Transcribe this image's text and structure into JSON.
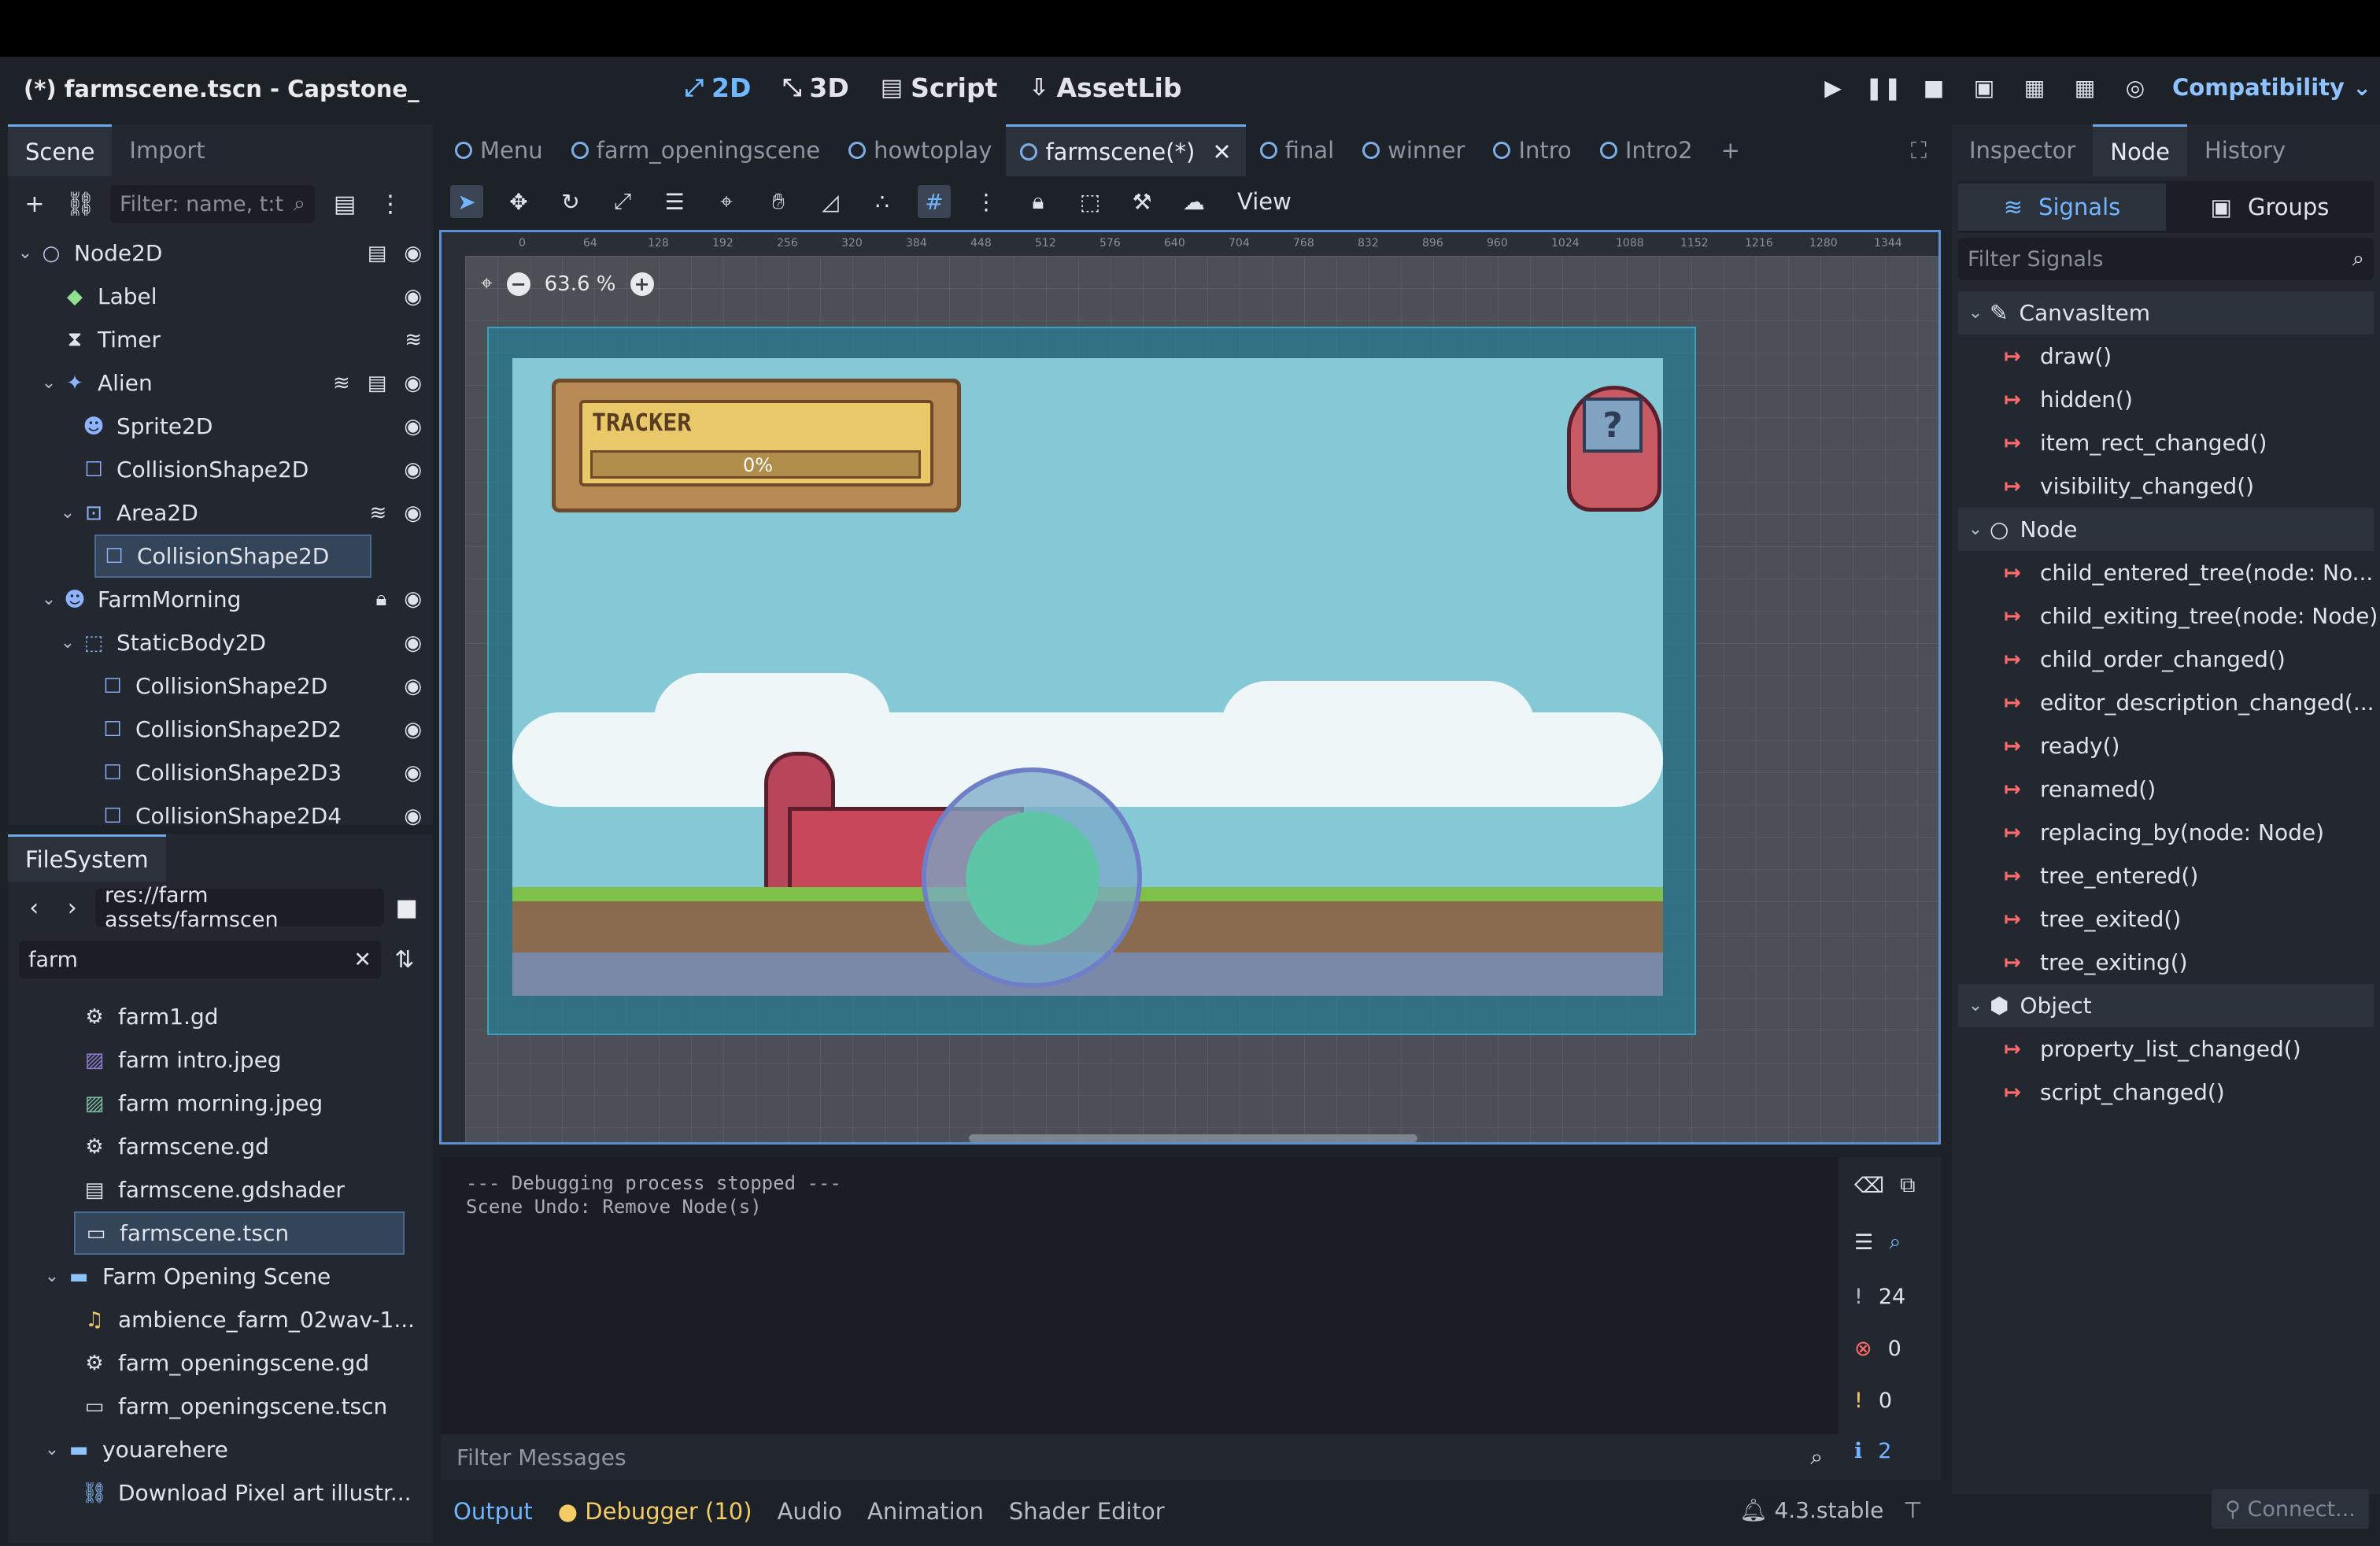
{
  "window": {
    "title": "(*) farmscene.tscn - Capstone_"
  },
  "main_buttons": [
    {
      "label": "2D",
      "icon": "2d-icon",
      "active": true
    },
    {
      "label": "3D",
      "icon": "3d-icon",
      "active": false
    },
    {
      "label": "Script",
      "icon": "script-icon",
      "active": false
    },
    {
      "label": "AssetLib",
      "icon": "assetlib-icon",
      "active": false
    }
  ],
  "renderer": "Compatibility",
  "scene_dock": {
    "tabs": [
      "Scene",
      "Import"
    ],
    "filter_placeholder": "Filter: name, t:t",
    "nodes": [
      {
        "label": "Node2D",
        "icon": "node2d-icon",
        "depth": 0,
        "expanded": true
      },
      {
        "label": "Label",
        "icon": "label-icon",
        "depth": 1
      },
      {
        "label": "Timer",
        "icon": "timer-icon",
        "depth": 1
      },
      {
        "label": "Alien",
        "icon": "character-icon",
        "depth": 1,
        "expanded": true
      },
      {
        "label": "Sprite2D",
        "icon": "sprite-icon",
        "depth": 2
      },
      {
        "label": "CollisionShape2D",
        "icon": "collision-icon",
        "depth": 2
      },
      {
        "label": "Area2D",
        "icon": "area-icon",
        "depth": 2,
        "expanded": true
      },
      {
        "label": "CollisionShape2D",
        "icon": "collision-icon",
        "depth": 3,
        "selected": true
      },
      {
        "label": "FarmMorning",
        "icon": "sprite-icon",
        "depth": 1,
        "expanded": true
      },
      {
        "label": "StaticBody2D",
        "icon": "staticbody-icon",
        "depth": 2,
        "expanded": true
      },
      {
        "label": "CollisionShape2D",
        "icon": "collision-icon",
        "depth": 3
      },
      {
        "label": "CollisionShape2D2",
        "icon": "collision-icon",
        "depth": 3
      },
      {
        "label": "CollisionShape2D3",
        "icon": "collision-icon",
        "depth": 3
      },
      {
        "label": "CollisionShape2D4",
        "icon": "collision-icon",
        "depth": 3
      }
    ]
  },
  "filesystem": {
    "tab": "FileSystem",
    "path": "res://farm assets/farmscen",
    "search": "farm",
    "items": [
      {
        "label": "farm1.gd",
        "icon": "gear-icon",
        "depth": 1
      },
      {
        "label": "farm intro.jpeg",
        "icon": "image-icon",
        "depth": 1
      },
      {
        "label": "farm morning.jpeg",
        "icon": "image-icon",
        "depth": 1
      },
      {
        "label": "farmscene.gd",
        "icon": "gear-icon",
        "depth": 1
      },
      {
        "label": "farmscene.gdshader",
        "icon": "shader-icon",
        "depth": 1
      },
      {
        "label": "farmscene.tscn",
        "icon": "scene-icon",
        "depth": 1,
        "selected": true
      },
      {
        "label": "Farm Opening Scene",
        "icon": "folder-icon",
        "depth": 0,
        "folder": true
      },
      {
        "label": "ambience_farm_02wav-1...",
        "icon": "audio-icon",
        "depth": 1
      },
      {
        "label": "farm_openingscene.gd",
        "icon": "gear-icon",
        "depth": 1
      },
      {
        "label": "farm_openingscene.tscn",
        "icon": "scene-icon",
        "depth": 1
      },
      {
        "label": "youarehere",
        "icon": "folder-icon",
        "depth": 0,
        "folder": true
      },
      {
        "label": "Download Pixel art illustr...",
        "icon": "link-icon",
        "depth": 1
      }
    ]
  },
  "editor_tabs": [
    {
      "label": "Menu",
      "active": false
    },
    {
      "label": "farm_openingscene",
      "active": false
    },
    {
      "label": "howtoplay",
      "active": false
    },
    {
      "label": "farmscene(*)",
      "active": true
    },
    {
      "label": "final",
      "active": false
    },
    {
      "label": "winner",
      "active": false
    },
    {
      "label": "Intro",
      "active": false
    },
    {
      "label": "Intro2",
      "active": false
    }
  ],
  "toolbar": {
    "view_label": "View"
  },
  "viewport": {
    "zoom": "63.6 %",
    "ruler_labels": [
      "0",
      "64",
      "128",
      "192",
      "256",
      "320",
      "384",
      "448",
      "512",
      "576",
      "640",
      "704",
      "768",
      "832",
      "896",
      "960",
      "1024",
      "1088",
      "1152",
      "1216",
      "1280",
      "1344"
    ],
    "tracker_title": "TRACKER",
    "tracker_value": "0%",
    "question_mark": "?"
  },
  "output": {
    "lines": "--- Debugging process stopped ---\nScene Undo: Remove Node(s)",
    "filter_placeholder": "Filter Messages",
    "counts": {
      "messages": "24",
      "errors": "0",
      "warnings": "0",
      "info": "2"
    }
  },
  "bottom_tabs": [
    "Output",
    "Debugger (10)",
    "Audio",
    "Animation",
    "Shader Editor"
  ],
  "version": "4.3.stable",
  "right_dock": {
    "tabs": [
      "Inspector",
      "Node",
      "History"
    ],
    "subtabs": [
      "Signals",
      "Groups"
    ],
    "filter_placeholder": "Filter Signals",
    "groups": [
      {
        "name": "CanvasItem",
        "signals": [
          "draw()",
          "hidden()",
          "item_rect_changed()",
          "visibility_changed()"
        ]
      },
      {
        "name": "Node",
        "signals": [
          "child_entered_tree(node: No...",
          "child_exiting_tree(node: Node)",
          "child_order_changed()",
          "editor_description_changed(...",
          "ready()",
          "renamed()",
          "replacing_by(node: Node)",
          "tree_entered()",
          "tree_exited()",
          "tree_exiting()"
        ]
      },
      {
        "name": "Object",
        "signals": [
          "property_list_changed()",
          "script_changed()"
        ]
      }
    ],
    "connect_label": "Connect..."
  }
}
